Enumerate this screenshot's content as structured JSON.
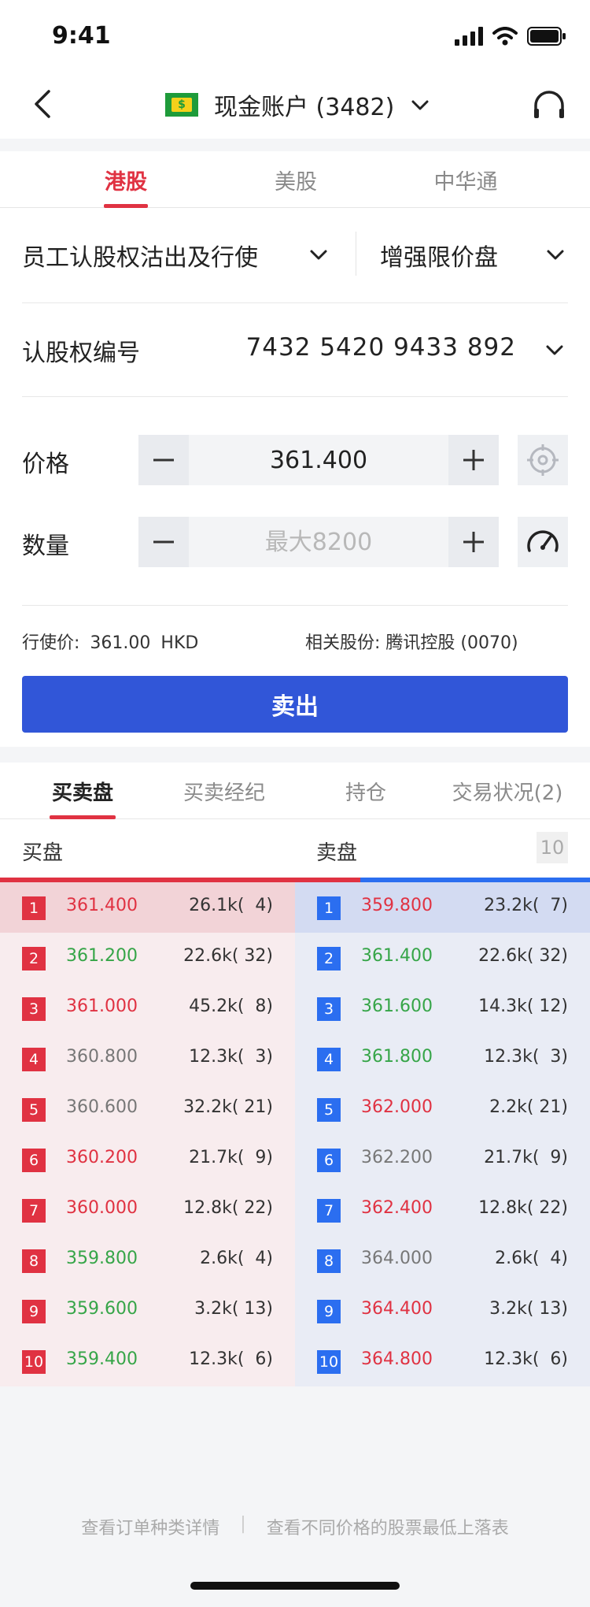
{
  "status": {
    "time": "9:41"
  },
  "nav": {
    "account_title": "现金账户 (3482)",
    "flag_label": "$"
  },
  "market_tabs": [
    {
      "label": "港股",
      "active": true
    },
    {
      "label": "美股",
      "active": false
    },
    {
      "label": "中华通",
      "active": false
    }
  ],
  "form": {
    "order_category": "员工认股权沽出及行使",
    "order_type": "增强限价盘",
    "warrant_label": "认股权编号",
    "warrant_number": "7432 5420 9433 892",
    "price_label": "价格",
    "price_value": "361.400",
    "qty_label": "数量",
    "qty_placeholder": "最大8200",
    "exercise_label": "行使价:",
    "exercise_price": "361.00",
    "exercise_currency": "HKD",
    "related_label": "相关股份:",
    "related_stock": "腾讯控股 (0070)",
    "sell_label": "卖出"
  },
  "bottom_tabs": [
    {
      "label": "买卖盘",
      "active": true
    },
    {
      "label": "买卖经纪",
      "active": false
    },
    {
      "label": "持仓",
      "active": false
    },
    {
      "label": "交易状况(2)",
      "active": false
    }
  ],
  "orderbook": {
    "bid_label": "买盘",
    "ask_label": "卖盘",
    "depth": "10",
    "bids": [
      {
        "level": "1",
        "price": "361.400",
        "color": "red",
        "volume": "26.1k(  4)"
      },
      {
        "level": "2",
        "price": "361.200",
        "color": "green",
        "volume": "22.6k( 32)"
      },
      {
        "level": "3",
        "price": "361.000",
        "color": "red",
        "volume": "45.2k(  8)"
      },
      {
        "level": "4",
        "price": "360.800",
        "color": "gray",
        "volume": "12.3k(  3)"
      },
      {
        "level": "5",
        "price": "360.600",
        "color": "gray",
        "volume": "32.2k( 21)"
      },
      {
        "level": "6",
        "price": "360.200",
        "color": "red",
        "volume": "21.7k(  9)"
      },
      {
        "level": "7",
        "price": "360.000",
        "color": "red",
        "volume": "12.8k( 22)"
      },
      {
        "level": "8",
        "price": "359.800",
        "color": "green",
        "volume": "2.6k(  4)"
      },
      {
        "level": "9",
        "price": "359.600",
        "color": "green",
        "volume": "3.2k( 13)"
      },
      {
        "level": "10",
        "price": "359.400",
        "color": "green",
        "volume": "12.3k(  6)"
      }
    ],
    "asks": [
      {
        "level": "1",
        "price": "359.800",
        "color": "red",
        "volume": "23.2k(  7)"
      },
      {
        "level": "2",
        "price": "361.400",
        "color": "green",
        "volume": "22.6k( 32)"
      },
      {
        "level": "3",
        "price": "361.600",
        "color": "green",
        "volume": "14.3k( 12)"
      },
      {
        "level": "4",
        "price": "361.800",
        "color": "green",
        "volume": "12.3k(  3)"
      },
      {
        "level": "5",
        "price": "362.000",
        "color": "red",
        "volume": "2.2k( 21)"
      },
      {
        "level": "6",
        "price": "362.200",
        "color": "gray",
        "volume": "21.7k(  9)"
      },
      {
        "level": "7",
        "price": "362.400",
        "color": "red",
        "volume": "12.8k( 22)"
      },
      {
        "level": "8",
        "price": "364.000",
        "color": "gray",
        "volume": "2.6k(  4)"
      },
      {
        "level": "9",
        "price": "364.400",
        "color": "red",
        "volume": "3.2k( 13)"
      },
      {
        "level": "10",
        "price": "364.800",
        "color": "red",
        "volume": "12.3k(  6)"
      }
    ]
  },
  "footer": {
    "link1": "查看订单种类详情",
    "separator": "|",
    "link2": "查看不同价格的股票最低上落表"
  },
  "colors": {
    "accent_red": "#e03242",
    "primary_blue": "#3156d8",
    "ask_blue": "#2b6ef0",
    "green": "#36a548"
  }
}
